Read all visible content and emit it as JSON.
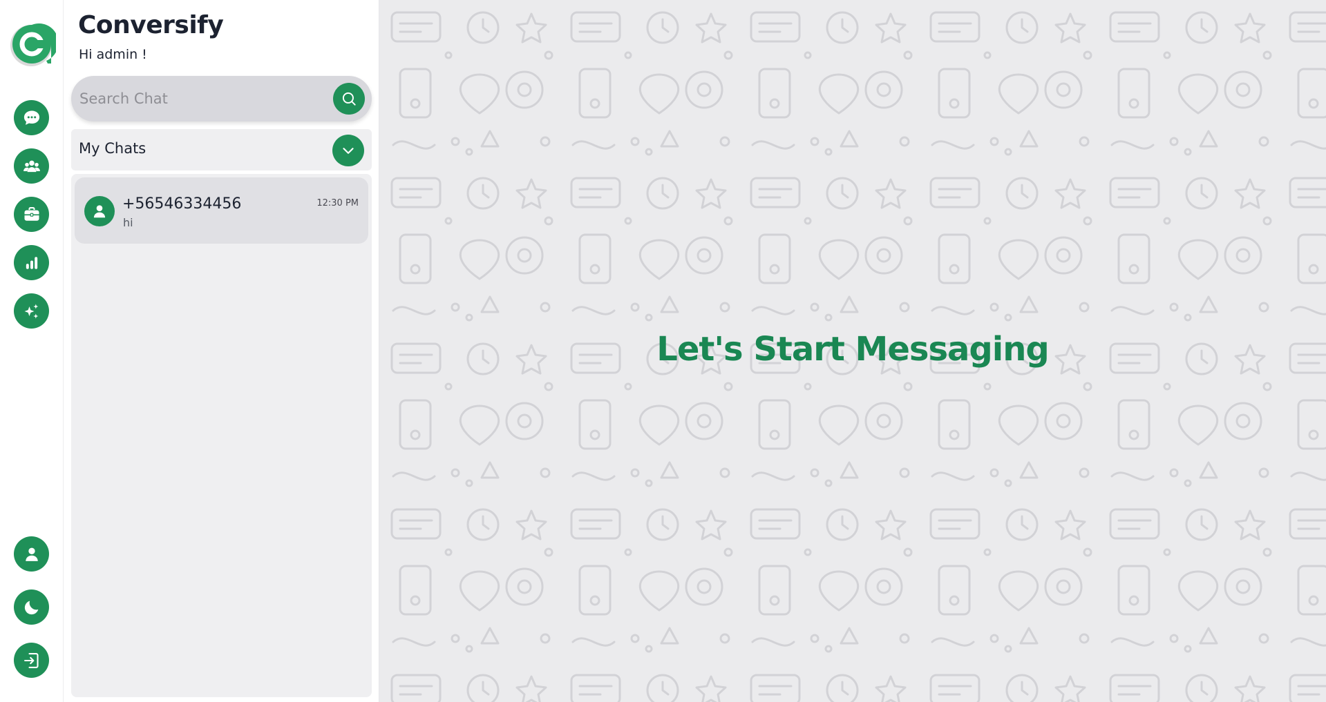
{
  "app": {
    "name": "Conversify",
    "greeting": "Hi admin !"
  },
  "colors": {
    "accent": "#1f9058",
    "headline": "#1a8753",
    "background": "#ebebed"
  },
  "rail": {
    "top_items": [
      {
        "icon": "chat-bubble-icon"
      },
      {
        "icon": "group-icon"
      },
      {
        "icon": "briefcase-icon"
      },
      {
        "icon": "bar-chart-icon"
      },
      {
        "icon": "sparkles-icon"
      }
    ],
    "bottom_items": [
      {
        "icon": "profile-icon"
      },
      {
        "icon": "moon-icon"
      },
      {
        "icon": "logout-icon"
      }
    ]
  },
  "search": {
    "placeholder": "Search Chat"
  },
  "chats": {
    "section_label": "My Chats",
    "items": [
      {
        "name": "+56546334456",
        "time": "12:30 PM",
        "preview": "hi"
      }
    ]
  },
  "main": {
    "headline": "Let's Start Messaging"
  }
}
